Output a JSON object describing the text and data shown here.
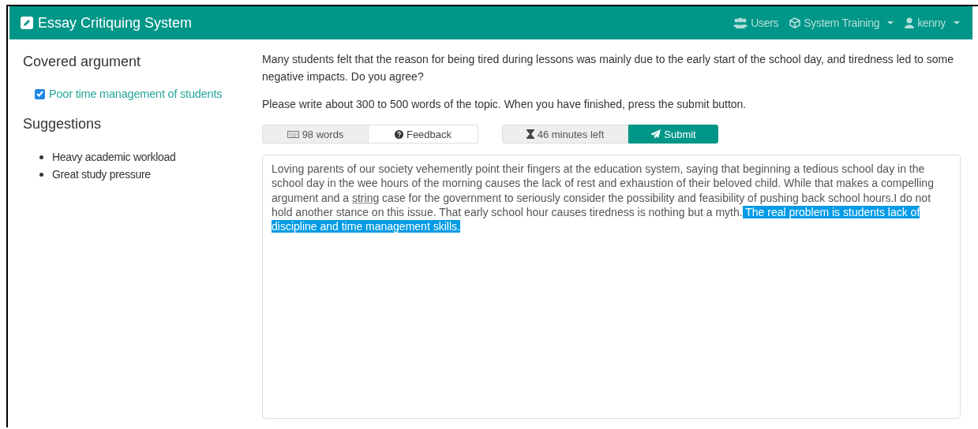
{
  "navbar": {
    "title": "Essay Critiquing System",
    "links": [
      {
        "label": "Users",
        "kind": "users",
        "dropdown": false
      },
      {
        "label": "System Training",
        "kind": "box",
        "dropdown": true
      },
      {
        "label": "kenny",
        "kind": "user",
        "dropdown": true
      }
    ]
  },
  "sidebar": {
    "covered_heading": "Covered argument",
    "covered": [
      {
        "label": "Poor time management of students",
        "checked": true
      }
    ],
    "suggestions_heading": "Suggestions",
    "suggestions": [
      "Heavy academic workload",
      "Great study pressure"
    ]
  },
  "prompt": {
    "question": "Many students felt that the reason for being tired during lessons was mainly due to the early start of the school day, and tiredness led to some negative impacts. Do you agree?",
    "instruction": "Please write about 300 to 500 words of the topic. When you have finished, press the submit button."
  },
  "toolbar": {
    "word_count": "98 words",
    "feedback": "Feedback",
    "time_left": "46 minutes left",
    "submit": "Submit"
  },
  "essay": [
    {
      "kind": "plain",
      "text": "Loving parents of our society vehemently point their fingers at the education system, saying that beginning a tedious school day in the school day in the wee hours of the morning causes the lack of rest and exhaustion of their beloved child. While that makes a compelling argument and a "
    },
    {
      "kind": "misspelled",
      "text": "string"
    },
    {
      "kind": "plain",
      "text": " case for the government to seriously consider the possibility and feasibility of pushing back school hours.I do not hold another stance on this issue. That early school hour causes tiredness is nothing but a myth."
    },
    {
      "kind": "selected",
      "text": " The real problem is students lack of discipline and time management skills."
    }
  ]
}
